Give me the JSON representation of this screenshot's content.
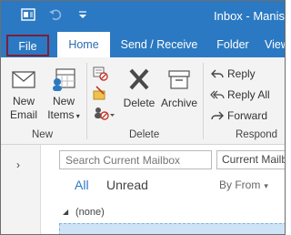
{
  "titlebar": {
    "title": "Inbox - Manish",
    "icons": [
      "outlook-app-icon",
      "undo-icon",
      "quick-access-dropdown-icon"
    ]
  },
  "tabs": [
    {
      "label": "File",
      "highlighted": true
    },
    {
      "label": "Home",
      "selected": true
    },
    {
      "label": "Send / Receive"
    },
    {
      "label": "Folder"
    },
    {
      "label": "View"
    }
  ],
  "ribbon": {
    "new_group": {
      "label": "New",
      "new_email": "New Email",
      "new_email_line1": "New",
      "new_email_line2": "Email",
      "new_items_line1": "New",
      "new_items_line2": "Items"
    },
    "delete_group": {
      "label": "Delete",
      "delete": "Delete",
      "archive": "Archive"
    },
    "respond_group": {
      "label": "Respond",
      "reply": "Reply",
      "reply_all": "Reply All",
      "forward": "Forward"
    }
  },
  "search": {
    "placeholder": "Search Current Mailbox",
    "scope": "Current Mailbox"
  },
  "filters": {
    "all": "All",
    "unread": "Unread",
    "sort": "By From"
  },
  "message_list": {
    "group_label": "(none)"
  },
  "colors": {
    "title_bar": "#2b79c2",
    "file_highlight": "#7c1f3a",
    "accent": "#2b79c2"
  }
}
